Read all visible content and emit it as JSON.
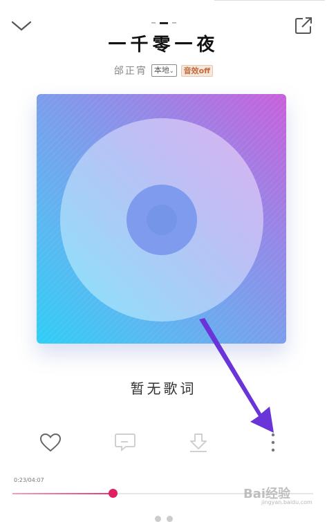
{
  "header": {
    "title": "一千零一夜",
    "artist": "邰正宵",
    "source_badge": "本地",
    "effect_badge": "音效off",
    "collapse_icon": "chevron-down-icon",
    "share_icon": "share-external-icon"
  },
  "album_art": {
    "icon": "vinyl-disc-icon",
    "colors": [
      "#c85fdb",
      "#8f8ce8",
      "#5ab8f1",
      "#2ecef6"
    ]
  },
  "lyrics": {
    "placeholder": "暂无歌词"
  },
  "actions": [
    {
      "name": "like",
      "icon": "heart-icon"
    },
    {
      "name": "comment",
      "icon": "comment-icon"
    },
    {
      "name": "download",
      "icon": "download-icon"
    },
    {
      "name": "more",
      "icon": "more-vertical-icon"
    }
  ],
  "playback": {
    "time_display": "0:23/04:07",
    "progress": 0.335,
    "accent_color": "#e0215f"
  },
  "annotation": {
    "arrow_color": "#6a35d8",
    "arrow_icon": "arrow-pointer-icon"
  },
  "watermark": {
    "brand": "Bai经验",
    "sub": "jingyan.baidu.com"
  }
}
